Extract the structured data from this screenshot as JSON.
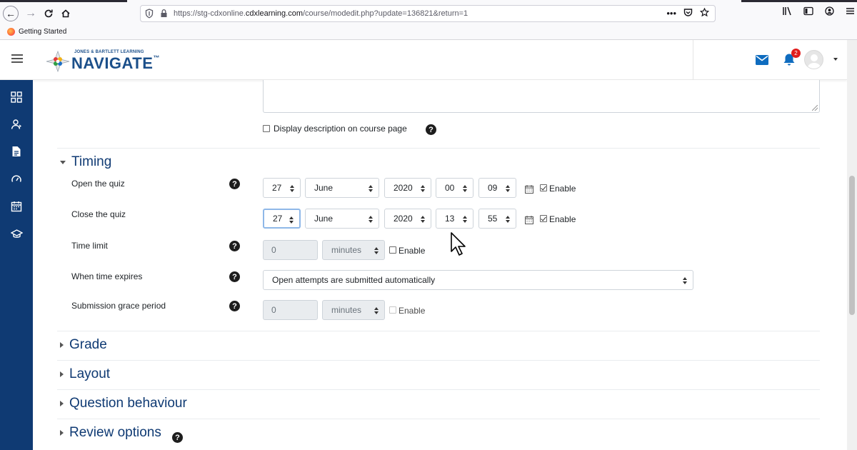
{
  "browser": {
    "url_prefix": "https://stg-cdxonline.",
    "url_domain": "cdxlearning.com",
    "url_path": "/course/modedit.php?update=136821&return=1",
    "bookmark": "Getting Started",
    "more_actions": "•••"
  },
  "header": {
    "logo_top": "JONES & BARTLETT LEARNING",
    "logo_main": "NAVIGATE",
    "logo_mark": "™",
    "notification_count": "2"
  },
  "description": {
    "display_on_course_label": "Display description on course page"
  },
  "help_glyph": "?",
  "timing": {
    "title": "Timing",
    "open": {
      "label": "Open the quiz",
      "day": "27",
      "month": "June",
      "year": "2020",
      "hour": "00",
      "minute": "09",
      "enable_label": "Enable",
      "enabled": true
    },
    "close": {
      "label": "Close the quiz",
      "day": "27",
      "month": "June",
      "year": "2020",
      "hour": "13",
      "minute": "55",
      "enable_label": "Enable",
      "enabled": true
    },
    "time_limit": {
      "label": "Time limit",
      "value": "0",
      "unit": "minutes",
      "enable_label": "Enable"
    },
    "when_expires": {
      "label": "When time expires",
      "value": "Open attempts are submitted automatically"
    },
    "grace_period": {
      "label": "Submission grace period",
      "value": "0",
      "unit": "minutes",
      "enable_label": "Enable"
    }
  },
  "sections": [
    {
      "title": "Grade"
    },
    {
      "title": "Layout"
    },
    {
      "title": "Question behaviour"
    },
    {
      "title": "Review options"
    }
  ],
  "colors": {
    "sidebar": "#0f3a73",
    "accent": "#0f6cbf",
    "section_title": "#0f3a73",
    "badge": "#e11d1d"
  }
}
